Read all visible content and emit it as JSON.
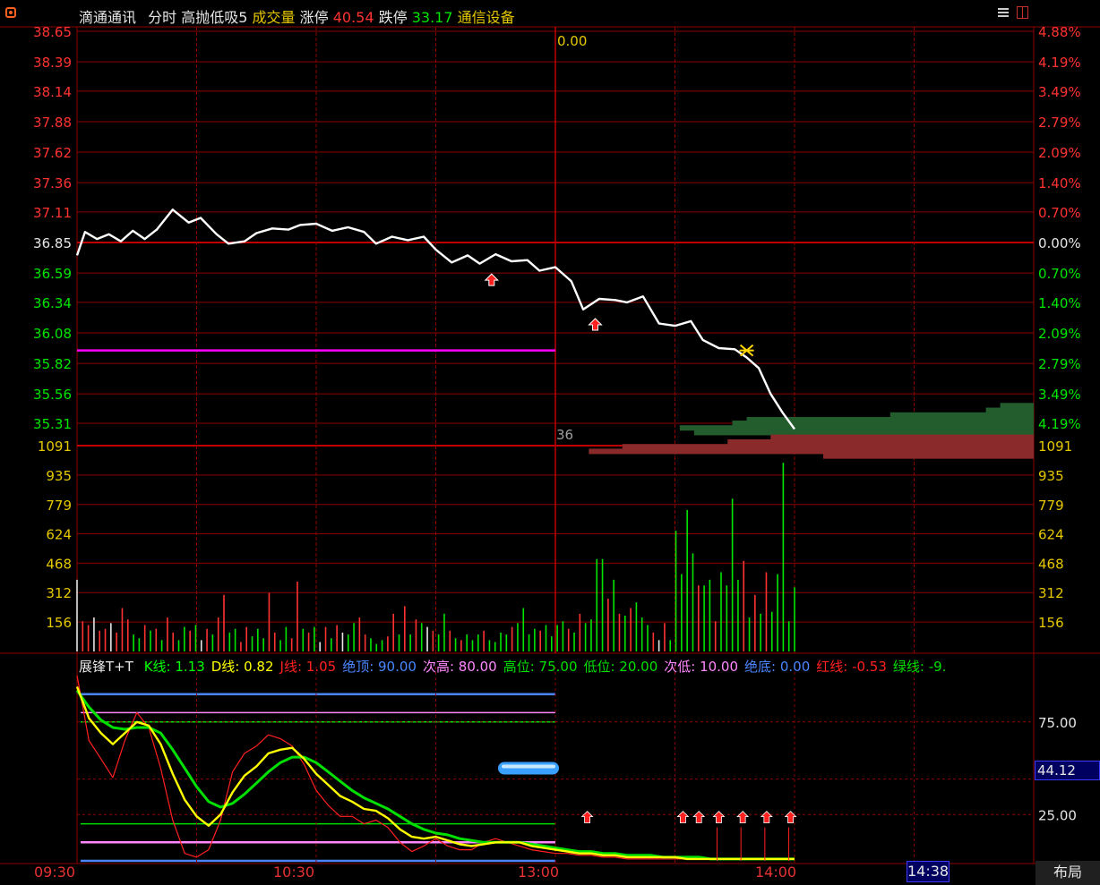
{
  "header": {
    "stock_name": "滴通通讯",
    "mode": "分时",
    "indicator": "高抛低吸5",
    "volume_label": "成交量",
    "limit_up_label": "涨停",
    "limit_up_value": "40.54",
    "limit_down_label": "跌停",
    "limit_down_value": "33.17",
    "sector": "通信设备"
  },
  "crosshair_value": "0.00",
  "last_price_tag": "36",
  "footer": {
    "time_labels": [
      "09:30",
      "10:30",
      "13:00",
      "14:00"
    ],
    "current_time": "14:38",
    "layout_button": "布局"
  },
  "colors": {
    "up": "#ff3232",
    "down": "#00e600",
    "grid": "#8b0000",
    "price_line": "#ffffff",
    "k_line": "#ffff00",
    "d_line": "#00e000",
    "j_line": "#ff2020",
    "magenta_line": "#ff00ff"
  },
  "chart_data": [
    {
      "type": "line",
      "panel": "price",
      "yticks_left": [
        "38.65",
        "38.39",
        "38.14",
        "37.88",
        "37.62",
        "37.36",
        "37.11",
        "36.85",
        "36.59",
        "36.34",
        "36.08",
        "35.82",
        "35.56",
        "35.31"
      ],
      "yticks_right": [
        "4.88%",
        "4.19%",
        "3.49%",
        "2.79%",
        "2.09%",
        "1.40%",
        "0.70%",
        "0.00%",
        "0.70%",
        "1.40%",
        "2.09%",
        "2.79%",
        "3.49%",
        "4.19%"
      ],
      "ylim": [
        35.18,
        38.65
      ],
      "reference_price": 36.85,
      "magenta_level": 35.93,
      "x_minutes": [
        0,
        2,
        5,
        8,
        11,
        14,
        17,
        20,
        24,
        28,
        31,
        35,
        38,
        42,
        45,
        49,
        53,
        56,
        60,
        64,
        68,
        72,
        75,
        79,
        83,
        87,
        90,
        94,
        98,
        101,
        105,
        109,
        113,
        116,
        120,
        124,
        127,
        131,
        135,
        138,
        142,
        146,
        150,
        154,
        157,
        161,
        165,
        168,
        171,
        174,
        177,
        180
      ],
      "price": [
        36.74,
        36.94,
        36.88,
        36.92,
        36.86,
        36.95,
        36.88,
        36.96,
        37.13,
        37.02,
        37.06,
        36.92,
        36.84,
        36.86,
        36.93,
        36.97,
        36.96,
        37.0,
        37.01,
        36.95,
        36.98,
        36.94,
        36.84,
        36.9,
        36.87,
        36.9,
        36.79,
        36.68,
        36.74,
        36.67,
        36.75,
        36.69,
        36.7,
        36.61,
        36.64,
        36.52,
        36.28,
        36.37,
        36.36,
        36.34,
        36.39,
        36.16,
        36.14,
        36.18,
        36.02,
        35.95,
        35.94,
        35.87,
        35.78,
        35.56,
        35.4,
        35.26
      ],
      "buy_arrows_minutes": [
        104,
        130
      ],
      "volume_profile": {
        "price_levels": [
          35.46,
          35.42,
          35.38,
          35.34,
          35.31,
          35.27,
          35.23,
          35.19,
          35.15,
          35.11,
          35.07,
          35.03
        ],
        "lengths_rel": [
          0.07,
          0.1,
          0.3,
          0.6,
          0.63,
          0.74,
          0.71,
          0.55,
          0.64,
          0.86,
          0.93,
          0.44
        ],
        "colors": [
          "#235d2e",
          "#235d2e",
          "#235d2e",
          "#235d2e",
          "#235d2e",
          "#235d2e",
          "#235d2e",
          "#8b2a2a",
          "#8b2a2a",
          "#8b2a2a",
          "#8b2a2a",
          "#8b2a2a"
        ]
      }
    },
    {
      "type": "bar",
      "panel": "volume",
      "yticks": [
        "1091",
        "935",
        "779",
        "624",
        "468",
        "312",
        "156"
      ],
      "ylim": [
        0,
        1091
      ],
      "volume": [
        380,
        160,
        140,
        180,
        110,
        120,
        150,
        100,
        230,
        170,
        90,
        70,
        140,
        110,
        120,
        60,
        180,
        100,
        60,
        130,
        110,
        140,
        60,
        120,
        90,
        180,
        300,
        100,
        120,
        50,
        130,
        80,
        120,
        70,
        310,
        100,
        60,
        130,
        70,
        370,
        120,
        100,
        130,
        50,
        130,
        70,
        140,
        100,
        90,
        150,
        180,
        90,
        70,
        40,
        60,
        80,
        200,
        90,
        240,
        90,
        170,
        150,
        130,
        110,
        90,
        200,
        110,
        70,
        60,
        90,
        60,
        90,
        110,
        60,
        50,
        100,
        90,
        130,
        150,
        230,
        90,
        120,
        110,
        140,
        80,
        140,
        160,
        120,
        100,
        200,
        150,
        170,
        490,
        490,
        280,
        380,
        200,
        190,
        230,
        260,
        180,
        140,
        100,
        60,
        150,
        60,
        640,
        410,
        750,
        520,
        350,
        350,
        380,
        160,
        420,
        350,
        810,
        380,
        480,
        180,
        300,
        200,
        420,
        210,
        410,
        1000,
        160,
        340
      ],
      "is_up": [
        0,
        1,
        1,
        0,
        1,
        1,
        0,
        1,
        1,
        1,
        0,
        0,
        1,
        0,
        1,
        0,
        1,
        1,
        0,
        0,
        1,
        0,
        0,
        1,
        0,
        1,
        1,
        0,
        0,
        1,
        1,
        0,
        0,
        0,
        1,
        1,
        0,
        0,
        1,
        1,
        0,
        1,
        0,
        0,
        1,
        0,
        1,
        0,
        0,
        0,
        1,
        1,
        0,
        0,
        0,
        1,
        1,
        0,
        1,
        0,
        1,
        0,
        0,
        1,
        0,
        0,
        1,
        0,
        1,
        0,
        0,
        0,
        1,
        0,
        0,
        0,
        0,
        1,
        0,
        0,
        0,
        0,
        1,
        0,
        0,
        0,
        0,
        1,
        0,
        1,
        0,
        0,
        0,
        0,
        1,
        0,
        1,
        0,
        1,
        0,
        0,
        0,
        1,
        0,
        1,
        0,
        0,
        0,
        0,
        0,
        1,
        0,
        0,
        1,
        0,
        0,
        0,
        0,
        1,
        0,
        1,
        0,
        1,
        0,
        0,
        0,
        0,
        0
      ],
      "is_white": [
        1,
        0,
        0,
        1,
        0,
        0,
        1,
        0,
        0,
        0,
        0,
        0,
        0,
        0,
        0,
        0,
        0,
        0,
        0,
        0,
        0,
        0,
        1,
        0,
        0,
        0,
        0,
        0,
        0,
        0,
        0,
        0,
        0,
        0,
        0,
        0,
        0,
        0,
        0,
        0,
        0,
        0,
        0,
        1,
        0,
        0,
        0,
        1,
        0,
        0,
        0,
        0,
        0,
        0,
        0,
        0,
        0,
        0,
        0,
        0,
        0,
        0,
        1,
        0,
        0,
        0,
        0,
        0,
        0,
        0,
        0,
        0,
        0,
        0,
        0,
        0,
        0,
        0,
        0,
        0,
        0,
        0,
        0,
        0,
        0,
        0,
        0,
        0,
        0,
        0,
        0,
        0,
        0,
        0,
        0,
        0,
        0,
        0,
        0,
        0,
        0,
        0,
        0,
        1,
        0,
        0,
        0,
        0,
        0,
        0,
        0,
        0,
        0,
        0,
        0,
        0,
        0,
        0,
        0,
        0,
        0,
        0,
        0,
        0,
        0,
        0,
        0,
        0
      ]
    },
    {
      "type": "line",
      "panel": "indicator",
      "title": "展锋T+T",
      "legend": [
        {
          "label": "K线:",
          "value": "1.13",
          "color": "#00ff00"
        },
        {
          "label": "D线:",
          "value": "0.82",
          "color": "#ffff00"
        },
        {
          "label": "J线:",
          "value": "1.05",
          "color": "#ff2020"
        },
        {
          "label": "绝顶:",
          "value": "90.00",
          "color": "#4a86ff"
        },
        {
          "label": "次高:",
          "value": "80.00",
          "color": "#ff88ff"
        },
        {
          "label": "高位:",
          "value": "75.00",
          "color": "#00e000"
        },
        {
          "label": "低位:",
          "value": "20.00",
          "color": "#00e000"
        },
        {
          "label": "次低:",
          "value": "10.00",
          "color": "#ff88ff"
        },
        {
          "label": "绝底:",
          "value": "0.00",
          "color": "#4a86ff"
        },
        {
          "label": "红线:",
          "value": "-0.53",
          "color": "#ff2020"
        },
        {
          "label": "绿线:",
          "value": "-9.",
          "color": "#00e000"
        }
      ],
      "yticks": [
        "75.00",
        "25.00"
      ],
      "current_value_tag": "44.12",
      "ylim": [
        0,
        100
      ],
      "levels": [
        {
          "value": 90,
          "color": "#4a86ff"
        },
        {
          "value": 80,
          "color": "#ff88ff"
        },
        {
          "value": 75,
          "color": "#00e000"
        },
        {
          "value": 20,
          "color": "#00e000"
        },
        {
          "value": 10,
          "color": "#ff88ff"
        },
        {
          "value": 0,
          "color": "#4a86ff"
        }
      ],
      "x_minutes": [
        0,
        3,
        6,
        9,
        12,
        15,
        18,
        21,
        24,
        27,
        30,
        33,
        36,
        39,
        42,
        45,
        48,
        51,
        54,
        57,
        60,
        63,
        66,
        69,
        72,
        75,
        78,
        81,
        84,
        87,
        90,
        93,
        96,
        99,
        102,
        105,
        108,
        111,
        114,
        117,
        120,
        123,
        126,
        129,
        132,
        135,
        138,
        141,
        144,
        147,
        150,
        153,
        156,
        159,
        162,
        165,
        168,
        171,
        174,
        177,
        180
      ],
      "K": [
        94,
        77,
        69,
        63,
        69,
        75,
        73,
        63,
        47,
        33,
        24,
        19,
        25,
        37,
        46,
        51,
        58,
        60,
        61,
        55,
        47,
        41,
        35,
        32,
        28,
        27,
        23,
        17,
        13,
        12,
        13,
        11,
        9,
        8,
        9,
        10,
        10,
        10,
        8,
        7,
        6,
        5,
        4,
        4,
        3,
        3,
        2,
        2,
        2,
        2,
        2,
        1,
        1,
        1,
        1,
        1,
        1,
        1,
        1,
        1,
        1
      ],
      "D": [
        92,
        83,
        76,
        72,
        71,
        72,
        72,
        69,
        60,
        50,
        40,
        32,
        29,
        31,
        36,
        42,
        48,
        53,
        56,
        56,
        53,
        48,
        43,
        38,
        34,
        31,
        28,
        24,
        20,
        17,
        15,
        14,
        12,
        11,
        10,
        10,
        10,
        10,
        9,
        8,
        7,
        6,
        5,
        5,
        4,
        4,
        3,
        3,
        3,
        2,
        2,
        2,
        2,
        1,
        1,
        1,
        1,
        1,
        1,
        1,
        1
      ],
      "J": [
        100,
        65,
        55,
        45,
        65,
        80,
        72,
        50,
        22,
        4,
        2,
        6,
        22,
        48,
        58,
        62,
        68,
        66,
        62,
        52,
        38,
        30,
        24,
        24,
        20,
        22,
        18,
        10,
        5,
        8,
        12,
        8,
        6,
        6,
        10,
        12,
        10,
        8,
        6,
        5,
        4,
        4,
        3,
        3,
        2,
        2,
        1,
        1,
        1,
        1,
        1,
        1,
        1,
        1,
        1,
        1,
        1,
        1,
        1,
        1,
        1
      ],
      "up_arrows_minutes": [
        128,
        152,
        156,
        161,
        167,
        173,
        179
      ]
    }
  ]
}
